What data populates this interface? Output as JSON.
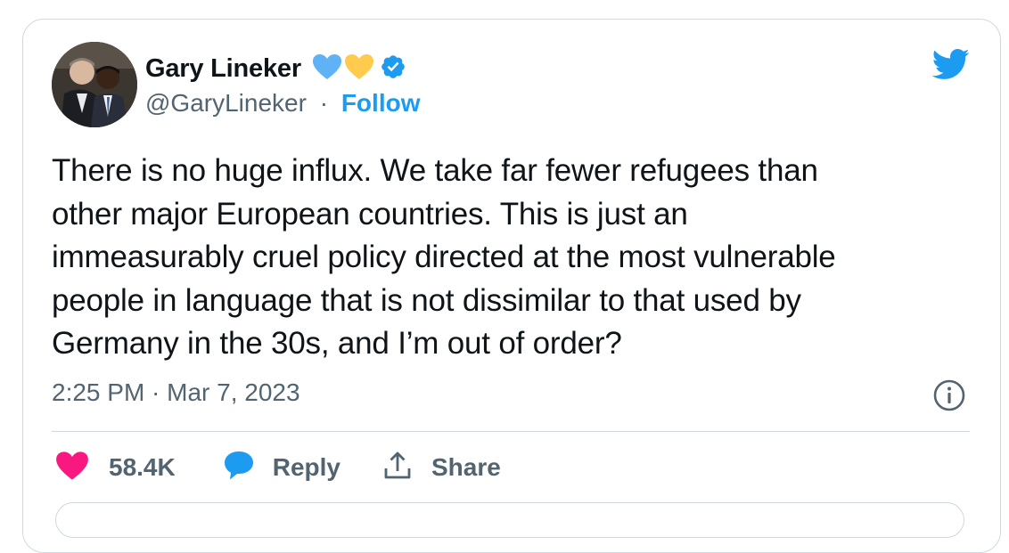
{
  "tweet": {
    "author": {
      "name": "Gary Lineker",
      "handle": "@GaryLineker",
      "follow_label": "Follow",
      "separator": "·",
      "verified_color": "#1d9bf0"
    },
    "text_lines": [
      "There is no huge influx. We take far fewer refugees than",
      "other major European countries. This is just an",
      "immeasurably cruel policy directed at the most vulnerable",
      "people in language that is not dissimilar to that used by",
      "Germany in the 30s, and I’m out of order?"
    ],
    "timestamp": "2:25 PM · Mar 7, 2023",
    "actions": {
      "likes_count": "58.4K",
      "reply_label": "Reply",
      "share_label": "Share"
    }
  },
  "colors": {
    "like": "#f91880",
    "reply": "#1d9bf0",
    "brand": "#1d9bf0",
    "blue_heart": "#5fb2f5",
    "yellow_heart": "#ffcb4c",
    "secondary_text": "#536471"
  },
  "icons": [
    "avatar-photo",
    "blue-heart-icon",
    "yellow-heart-icon",
    "verified-badge-icon",
    "twitter-bird-icon",
    "info-icon",
    "heart-icon",
    "reply-bubble-icon",
    "share-icon"
  ]
}
